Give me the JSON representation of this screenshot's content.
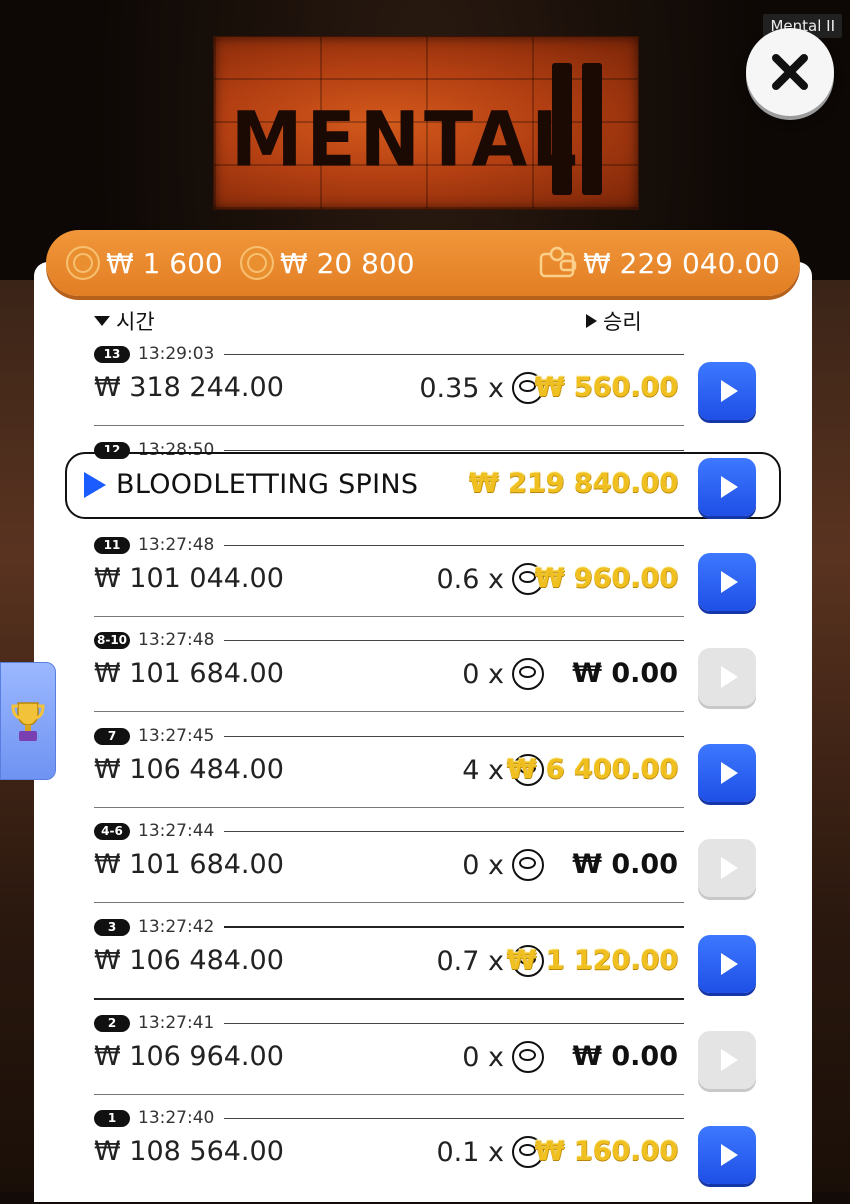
{
  "game_label": "Mental II",
  "logo_text": "MENTAL",
  "balance": {
    "bet": "₩ 1 600",
    "coin_value": "₩ 20 800",
    "wallet": "₩ 229 040.00"
  },
  "columns": {
    "time": "시간",
    "win": "승리"
  },
  "rows": [
    {
      "badge": "13",
      "time": "13:29:03",
      "bet": "₩ 318 244.00",
      "mult": "0.35 x",
      "win": "₩ 560.00",
      "win_style": "gold",
      "play_enabled": true
    },
    {
      "badge": "12",
      "time": "13:28:50",
      "bonus": "BLOODLETTING SPINS",
      "win": "₩ 219 840.00",
      "win_style": "gold",
      "play_enabled": true
    },
    {
      "badge": "11",
      "time": "13:27:48",
      "bet": "₩ 101 044.00",
      "mult": "0.6 x",
      "win": "₩ 960.00",
      "win_style": "gold",
      "play_enabled": true
    },
    {
      "badge": "8-10",
      "time": "13:27:48",
      "bet": "₩ 101 684.00",
      "mult": "0 x",
      "win": "₩ 0.00",
      "win_style": "zero",
      "play_enabled": false
    },
    {
      "badge": "7",
      "time": "13:27:45",
      "bet": "₩ 106 484.00",
      "mult": "4 x",
      "win": "₩ 6 400.00",
      "win_style": "gold",
      "play_enabled": true
    },
    {
      "badge": "4-6",
      "time": "13:27:44",
      "bet": "₩ 101 684.00",
      "mult": "0 x",
      "win": "₩ 0.00",
      "win_style": "zero",
      "play_enabled": false
    },
    {
      "badge": "3",
      "time": "13:27:42",
      "bet": "₩ 106 484.00",
      "mult": "0.7 x",
      "win": "₩ 1 120.00",
      "win_style": "gold",
      "play_enabled": true
    },
    {
      "badge": "2",
      "time": "13:27:41",
      "bet": "₩ 106 964.00",
      "mult": "0 x",
      "win": "₩ 0.00",
      "win_style": "zero",
      "play_enabled": false
    },
    {
      "badge": "1",
      "time": "13:27:40",
      "bet": "₩ 108 564.00",
      "mult": "0.1 x",
      "win": "₩ 160.00",
      "win_style": "gold",
      "play_enabled": true
    }
  ],
  "colors": {
    "accent_orange": "#e8852a",
    "play_blue": "#2a5ff0",
    "win_gold": "#f0c020"
  },
  "icons": {
    "close": "close-icon",
    "trophy": "trophy-icon",
    "coin": "coin-icon",
    "wallet": "wallet-icon",
    "play": "play-icon"
  }
}
